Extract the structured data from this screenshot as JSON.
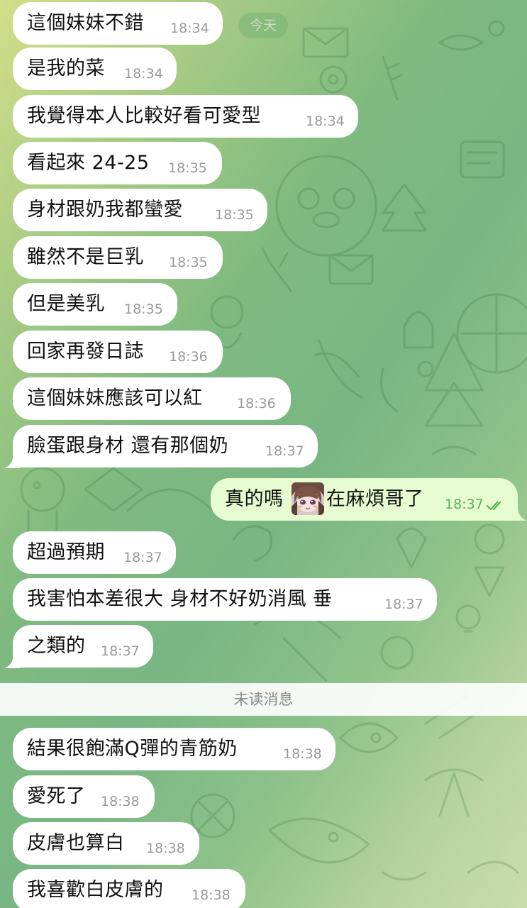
{
  "date_divider": "今天",
  "unread_divider": "未读消息",
  "colors": {
    "incoming_bubble": "#ffffff",
    "outgoing_bubble": "#e6fbcf",
    "outgoing_time": "#5ab25a"
  },
  "messages": [
    {
      "text": "這個妹妹不錯",
      "time": "18:34"
    },
    {
      "text": "是我的菜",
      "time": "18:34"
    },
    {
      "text": "我覺得本人比較好看可愛型",
      "time": "18:34"
    },
    {
      "text": "看起來 24-25",
      "time": "18:35"
    },
    {
      "text": "身材跟奶我都蠻愛",
      "time": "18:35"
    },
    {
      "text": "雖然不是巨乳",
      "time": "18:35"
    },
    {
      "text": "但是美乳",
      "time": "18:35"
    },
    {
      "text": "回家再發日誌",
      "time": "18:36"
    },
    {
      "text": "這個妹妹應該可以紅",
      "time": "18:36"
    },
    {
      "text": "臉蛋跟身材 還有那個奶",
      "time": "18:37"
    },
    {
      "text_before": "真的嗎",
      "emoji": "anime-girl-sticker",
      "text_after": "在麻煩哥了",
      "time": "18:37",
      "status_icon": "double-check-icon"
    },
    {
      "text": "超過預期",
      "time": "18:37"
    },
    {
      "text": "我害怕本差很大 身材不好奶消風 垂",
      "time": "18:37"
    },
    {
      "text": "之類的",
      "time": "18:37"
    },
    {
      "text": "結果很飽滿Q彈的青筋奶",
      "time": "18:38"
    },
    {
      "text": "愛死了",
      "time": "18:38"
    },
    {
      "text": "皮膚也算白",
      "time": "18:38"
    },
    {
      "text": "我喜歡白皮膚的",
      "time": "18:38"
    }
  ]
}
